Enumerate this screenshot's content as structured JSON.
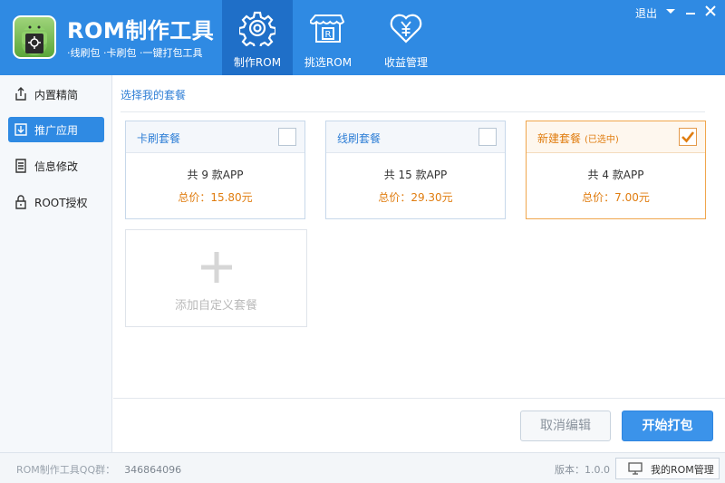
{
  "app": {
    "title": "ROM制作工具",
    "subtitle": "·线刷包  ·卡刷包  ·一键打包工具",
    "logout": "退出"
  },
  "nav": [
    {
      "label": "制作ROM",
      "icon": "gear-icon",
      "active": true
    },
    {
      "label": "挑选ROM",
      "icon": "shop-icon",
      "active": false
    },
    {
      "label": "收益管理",
      "icon": "heart-yen-icon",
      "active": false
    }
  ],
  "sidebar": {
    "items": [
      {
        "label": "内置精简",
        "icon": "export-icon",
        "active": false
      },
      {
        "label": "推广应用",
        "icon": "import-icon",
        "active": true
      },
      {
        "label": "信息修改",
        "icon": "document-icon",
        "active": false
      },
      {
        "label": "ROOT授权",
        "icon": "lock-icon",
        "active": false
      }
    ]
  },
  "main": {
    "section_title": "选择我的套餐",
    "packages": [
      {
        "name": "卡刷套餐",
        "tag": "",
        "count": "共 9 款APP",
        "price": "总价：15.80元",
        "selected": false
      },
      {
        "name": "线刷套餐",
        "tag": "",
        "count": "共 15 款APP",
        "price": "总价：29.30元",
        "selected": false
      },
      {
        "name": "新建套餐",
        "tag": "(已选中)",
        "count": "共 4 款APP",
        "price": "总价：7.00元",
        "selected": true
      }
    ],
    "add_package_label": "添加自定义套餐",
    "cancel_edit": "取消编辑",
    "start_pack": "开始打包"
  },
  "footer": {
    "qq_label": "ROM制作工具QQ群：",
    "qq_number": "346864096",
    "version": "版本：1.0.0",
    "my_rom": "我的ROM管理"
  },
  "colors": {
    "header": "#2f8ae3",
    "header_active": "#1f6fc8",
    "selected_orange": "#e07d10"
  }
}
